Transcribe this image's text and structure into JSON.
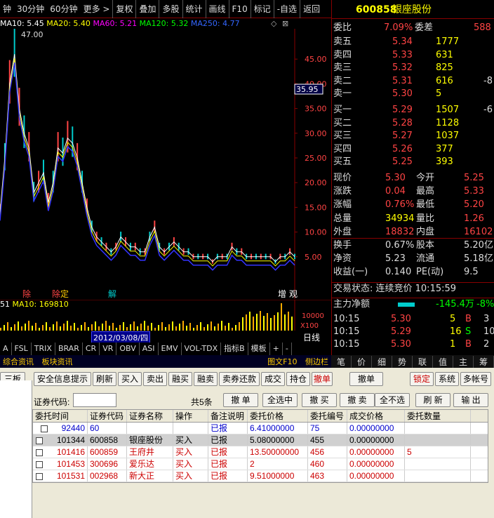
{
  "toolbar": {
    "items": [
      "钟",
      "30分钟",
      "60分钟",
      "更多 >",
      "复权",
      "叠加",
      "多股",
      "统计",
      "画线",
      "F10",
      "标记",
      "-自选",
      "返回"
    ]
  },
  "ma": {
    "ma10": "MA10: 5.45",
    "ma20": "MA20: 5.40",
    "ma60": "MA60: 5.21",
    "ma120": "MA120: 5.32",
    "ma250": "MA250: 4.77"
  },
  "chart_data": {
    "type": "line",
    "title": "",
    "y_ticks": [
      "45.00",
      "40.00",
      "35.00",
      "30.00",
      "25.00",
      "20.00",
      "15.00",
      "10.00",
      "5.00"
    ],
    "ylim": [
      0,
      50
    ],
    "high_label": "47.00",
    "current_price_tag": "35.95",
    "close_series": [
      14,
      25,
      40,
      46,
      35,
      30,
      27,
      18,
      20,
      22,
      16,
      20,
      27,
      26,
      29,
      28,
      25,
      20,
      15,
      11,
      9,
      8,
      7,
      6,
      7,
      9,
      8,
      7,
      7,
      6,
      6,
      9,
      11,
      7,
      6,
      7,
      8,
      7,
      6,
      6,
      5,
      5,
      5,
      5,
      4,
      5,
      5,
      5,
      7,
      6,
      6,
      5,
      5,
      5,
      5,
      5,
      5,
      4,
      5,
      5,
      6,
      5
    ]
  },
  "markers": [
    "除",
    "除",
    "定",
    "解",
    "增",
    "观"
  ],
  "volume": {
    "label_a": "51",
    "label_b": "MA10: 169810",
    "ticks": [
      "10000",
      "X100"
    ]
  },
  "date_label": "2012/03/08/四",
  "kline_label": "日线",
  "bottom_tabs": [
    "A",
    "FSL",
    "TRIX",
    "BRAR",
    "CR",
    "VR",
    "OBV",
    "ASI",
    "EMV",
    "VOL-TDX",
    "指标B",
    "模板",
    "+",
    "-"
  ],
  "info_row": {
    "left1": "综合资讯",
    "left2": "板块资讯",
    "right1": "图文F10",
    "right2": "侧边栏"
  },
  "stock": {
    "code": "600858",
    "name": "银座股份"
  },
  "weibi": {
    "label1": "委比",
    "val1": "7.09%",
    "label2": "委差",
    "val2": "588"
  },
  "asks": [
    {
      "label": "卖五",
      "price": "5.34",
      "vol": "1777"
    },
    {
      "label": "卖四",
      "price": "5.33",
      "vol": "631"
    },
    {
      "label": "卖三",
      "price": "5.32",
      "vol": "825"
    },
    {
      "label": "卖二",
      "price": "5.31",
      "vol": "616",
      "extra": "-8"
    },
    {
      "label": "卖一",
      "price": "5.30",
      "vol": "5"
    }
  ],
  "bids": [
    {
      "label": "买一",
      "price": "5.29",
      "vol": "1507",
      "extra": "-6"
    },
    {
      "label": "买二",
      "price": "5.28",
      "vol": "1128"
    },
    {
      "label": "买三",
      "price": "5.27",
      "vol": "1037"
    },
    {
      "label": "买四",
      "price": "5.26",
      "vol": "377"
    },
    {
      "label": "买五",
      "price": "5.25",
      "vol": "393"
    }
  ],
  "quote": [
    {
      "l1": "现价",
      "v1": "5.30",
      "l2": "今开",
      "v2": "5.25"
    },
    {
      "l1": "涨跌",
      "v1": "0.04",
      "l2": "最高",
      "v2": "5.33"
    },
    {
      "l1": "涨幅",
      "v1": "0.76%",
      "l2": "最低",
      "v2": "5.20"
    },
    {
      "l1": "总量",
      "v1": "34934",
      "l2": "量比",
      "v2": "1.26"
    },
    {
      "l1": "外盘",
      "v1": "18832",
      "l2": "内盘",
      "v2": "16102"
    },
    {
      "l1": "换手",
      "v1": "0.67%",
      "l2": "股本",
      "v2": "5.20亿"
    },
    {
      "l1": "净资",
      "v1": "5.23",
      "l2": "流通",
      "v2": "5.18亿"
    },
    {
      "l1": "收益(一)",
      "v1": "0.140",
      "l2": "PE(动)",
      "v2": "9.5"
    }
  ],
  "trade_status": "交易状态: 连续竞价 10:15:59",
  "net_flow": {
    "label": "主力净额",
    "value": "-145.4万",
    "pct": "-8%"
  },
  "ticks": [
    {
      "t": "10:15",
      "p": "5.30",
      "v": "5",
      "d": "B",
      "n": "3"
    },
    {
      "t": "10:15",
      "p": "5.29",
      "v": "16",
      "d": "S",
      "n": "10"
    },
    {
      "t": "10:15",
      "p": "5.30",
      "v": "1",
      "d": "B",
      "n": "2"
    }
  ],
  "right_tabs": [
    "笔",
    "价",
    "细",
    "势",
    "联",
    "值",
    "主",
    "筹"
  ],
  "trade": {
    "buttons_row1": [
      "三板",
      "安全信息提示",
      "刷新",
      "买入",
      "卖出",
      "融买",
      "融卖",
      "卖券还款",
      "成交",
      "持仓",
      "撤单",
      "撤单",
      "锁定",
      "系统",
      "多帐号"
    ],
    "code_label": "证券代码:",
    "count": "共5条",
    "buttons_row2": [
      "撤 单",
      "全选中",
      "撤 买",
      "撤 卖",
      "全不选",
      "刷 新",
      "输 出"
    ],
    "headers": [
      "委托时间",
      "证券代码",
      "证券名称",
      "操作",
      "备注说明",
      "委托价格",
      "委托编号",
      "成交价格",
      "委托数量"
    ],
    "rows": [
      {
        "time": "92440",
        "code": "60",
        "name": "",
        "op": "",
        "note": "已报",
        "price": "6.41000000",
        "no": "75",
        "dprice": "0.00000000",
        "qty": ""
      },
      {
        "time": "101344",
        "code": "600858",
        "name": "银座股份",
        "op": "买入",
        "note": "已报",
        "price": "5.08000000",
        "no": "455",
        "dprice": "0.00000000",
        "qty": ""
      },
      {
        "time": "101416",
        "code": "600859",
        "name": "王府井",
        "op": "买入",
        "note": "已报",
        "price": "13.50000000",
        "no": "456",
        "dprice": "0.00000000",
        "qty": "5"
      },
      {
        "time": "101453",
        "code": "300696",
        "name": "爱乐达",
        "op": "买入",
        "note": "已报",
        "price": "2",
        "no": "460",
        "dprice": "0.00000000",
        "qty": ""
      },
      {
        "time": "101531",
        "code": "002968",
        "name": "新大正",
        "op": "买入",
        "note": "已报",
        "price": "9.51000000",
        "no": "463",
        "dprice": "0.00000000",
        "qty": ""
      }
    ]
  }
}
